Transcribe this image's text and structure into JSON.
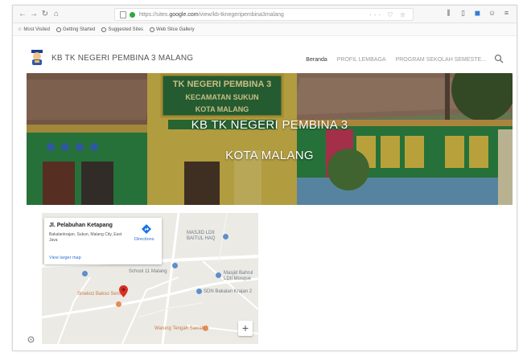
{
  "browser": {
    "url_prefix": "https://sites.",
    "url_domain": "google.com",
    "url_path": "/view/kb-tknegeripembina3malang",
    "url_right": "··· ♡ ☆",
    "bookmarks": [
      {
        "label": "Most Visited"
      },
      {
        "label": "Getting Started"
      },
      {
        "label": "Suggested Sites"
      },
      {
        "label": "Web Slice Gallery"
      }
    ]
  },
  "site": {
    "title": "KB TK NEGERI PEMBINA 3 MALANG",
    "menu": [
      {
        "label": "Beranda",
        "active": true
      },
      {
        "label": "PROFIL LEMBAGA",
        "active": false
      },
      {
        "label": "PROGRAM SEKOLAH SEMESTE...",
        "active": false
      }
    ]
  },
  "hero": {
    "line1": "KB TK NEGERI PEMBINA 3",
    "line2": "KOTA MALANG",
    "sign_line1": "TK NEGERI PEMBINA 3",
    "sign_line2": "KECAMATAN SUKUN",
    "sign_line3": "KOTA MALANG"
  },
  "map": {
    "card_title": "Jl. Pelabuhan Ketapang",
    "card_address": "Bakalankrajan, Sukun, Malang City, East Java",
    "card_link": "View larger map",
    "directions_label": "Directions",
    "labels": {
      "masjid": "MASJID LDII\nBAITUL HAQ",
      "school": "School 11 Malang",
      "mosque": "Masjid Bahrul\nLDII Mosque",
      "sdn": "SDN Bakalan Krajan 2",
      "shop": "Sinekoz Bakso Semen",
      "warung": "Warung Tengah Sawah"
    },
    "zoom_in": "+"
  }
}
